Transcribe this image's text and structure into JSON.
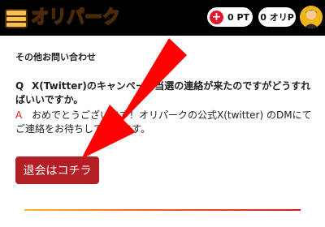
{
  "header": {
    "logo_text": "オリパーク",
    "points_label": "0 PT",
    "add_icon_glyph": "+",
    "orip_label": "0 オリP"
  },
  "faq": {
    "section_title": "その他お問い合わせ",
    "question_mark": "Q",
    "question_text": "X(Twitter)のキャンペーン当選の連絡が来たのですがどうすればいいですか。",
    "answer_mark": "A",
    "answer_text": "おめでとうございます！オリパークの公式X(twitter) のDMにてご連絡をお待ちしております。"
  },
  "actions": {
    "leave_label": "退会はコチラ"
  },
  "colors": {
    "header_bg": "#000000",
    "accent_red": "#e0182d",
    "button_red": "#b41f25",
    "arrow_red": "#ff0000",
    "logo_gold": "#f4c24d"
  },
  "icons": {
    "logo": "treasure-chest-icon",
    "add": "plus-circle-icon",
    "avatar": "user-avatar-icon",
    "annotation": "red-arrow-icon"
  }
}
